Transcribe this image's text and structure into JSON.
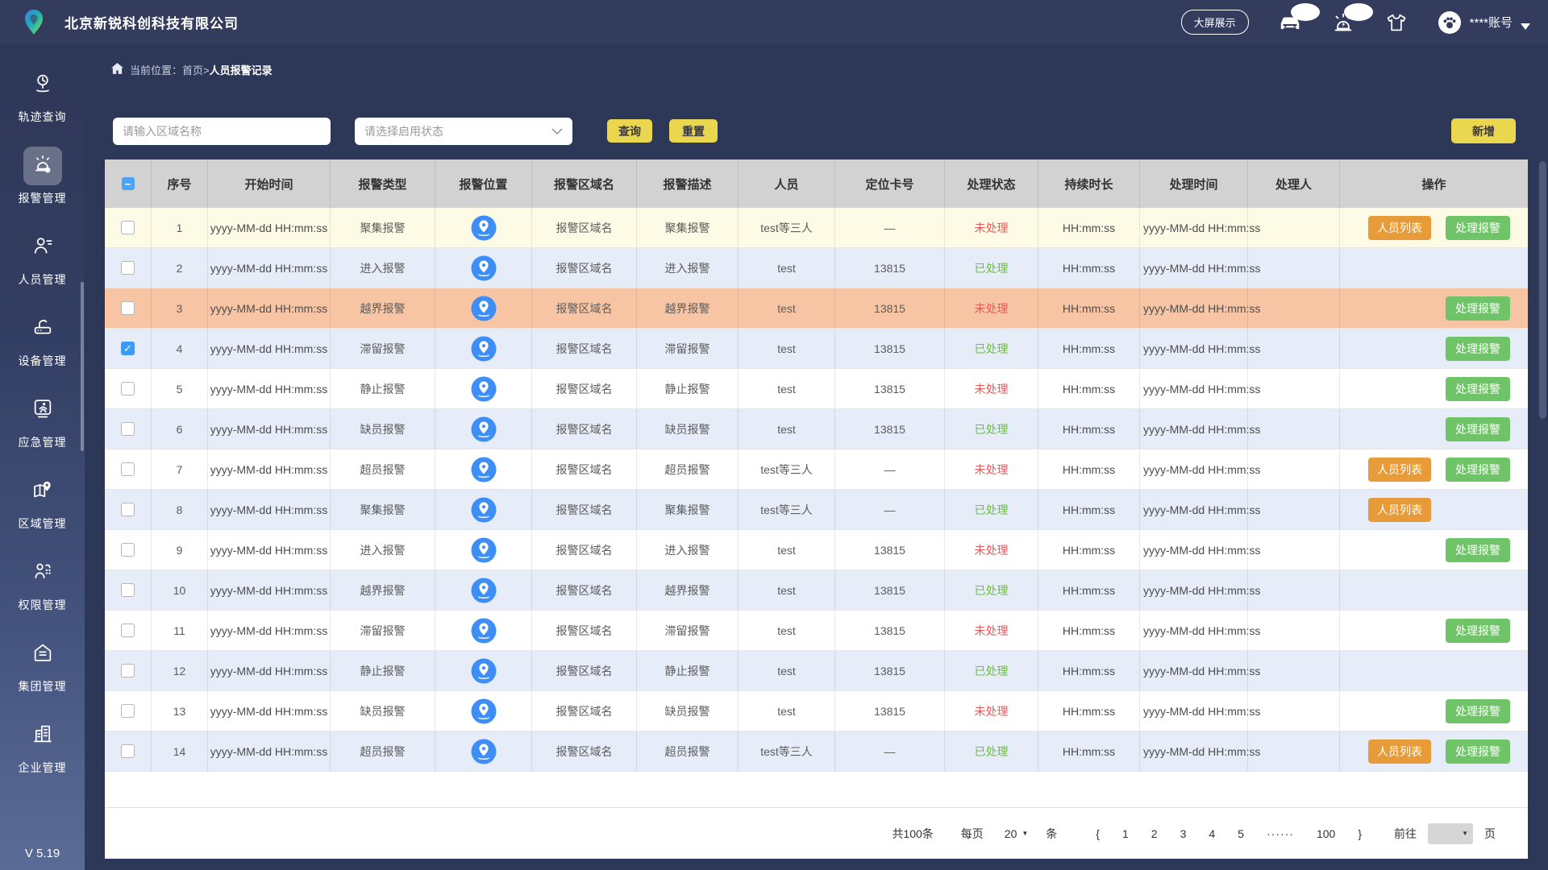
{
  "colors": {
    "topbar_bg": "#343c5e",
    "content_bg": "#2d3757",
    "accent_yellow": "#ead74f",
    "row_yellow": "#fdfbe6",
    "row_blue": "#e7ecf9",
    "row_orange": "#f8c5a4",
    "status_pending_red": "#f25555",
    "status_done_green": "#67c23a",
    "btn_orange": "#e79c39",
    "btn_green": "#6fc467",
    "loc_icon_blue": "#3e8ef7",
    "header_gray": "#d2d2d2"
  },
  "header": {
    "company": "北京新锐科创科技有限公司",
    "bigscreen_label": "大屏展示",
    "account": "****账号",
    "icons": [
      "car-icon",
      "siren-icon",
      "tshirt-icon",
      "paw-avatar-icon",
      "chevron-down-icon"
    ]
  },
  "sidebar": {
    "items": [
      {
        "label": "轨迹查询",
        "icon": "track",
        "active": false
      },
      {
        "label": "报警管理",
        "icon": "alarm",
        "active": true
      },
      {
        "label": "人员管理",
        "icon": "person",
        "active": false
      },
      {
        "label": "设备管理",
        "icon": "device",
        "active": false
      },
      {
        "label": "应急管理",
        "icon": "emergency",
        "active": false
      },
      {
        "label": "区域管理",
        "icon": "area",
        "active": false
      },
      {
        "label": "权限管理",
        "icon": "permission",
        "active": false
      },
      {
        "label": "集团管理",
        "icon": "group",
        "active": false
      },
      {
        "label": "企业管理",
        "icon": "enterprise",
        "active": false
      }
    ],
    "version": "V 5.19"
  },
  "breadcrumb": {
    "prefix": "当前位置：首页>",
    "current": "人员报警记录"
  },
  "filters": {
    "area_placeholder": "请输入区域名称",
    "status_placeholder": "请选择启用状态",
    "search_label": "查询",
    "reset_label": "重置",
    "add_label": "新增"
  },
  "table": {
    "columns": [
      "序号",
      "开始时间",
      "报警类型",
      "报警位置",
      "报警区域名",
      "报警描述",
      "人员",
      "定位卡号",
      "处理状态",
      "持续时长",
      "处理时间",
      "处理人",
      "操作"
    ],
    "action_labels": {
      "person_list": "人员列表",
      "handle": "处理报警"
    },
    "header_checkbox_state": "indeterminate",
    "rows": [
      {
        "no": "1",
        "start": "yyyy-MM-dd HH:mm:ss",
        "type": "聚集报警",
        "area": "报警区域名",
        "desc": "聚集报警",
        "person": "test等三人",
        "card": "—",
        "status": "未处理",
        "status_type": "pending",
        "duration": "HH:mm:ss",
        "handle_time": "yyyy-MM-dd HH:mm:ss",
        "handler": "",
        "checked": false,
        "bg": "yellow",
        "buttons": [
          "person_list",
          "handle"
        ]
      },
      {
        "no": "2",
        "start": "yyyy-MM-dd HH:mm:ss",
        "type": "进入报警",
        "area": "报警区域名",
        "desc": "进入报警",
        "person": "test",
        "card": "13815",
        "status": "已处理",
        "status_type": "done",
        "duration": "HH:mm:ss",
        "handle_time": "yyyy-MM-dd HH:mm:ss",
        "handler": "",
        "checked": false,
        "bg": "blue",
        "buttons": []
      },
      {
        "no": "3",
        "start": "yyyy-MM-dd HH:mm:ss",
        "type": "越界报警",
        "area": "报警区域名",
        "desc": "越界报警",
        "person": "test",
        "card": "13815",
        "status": "未处理",
        "status_type": "pending",
        "duration": "HH:mm:ss",
        "handle_time": "yyyy-MM-dd HH:mm:ss",
        "handler": "",
        "checked": false,
        "bg": "orange",
        "buttons": [
          "handle"
        ]
      },
      {
        "no": "4",
        "start": "yyyy-MM-dd HH:mm:ss",
        "type": "滞留报警",
        "area": "报警区域名",
        "desc": "滞留报警",
        "person": "test",
        "card": "13815",
        "status": "已处理",
        "status_type": "done",
        "duration": "HH:mm:ss",
        "handle_time": "yyyy-MM-dd HH:mm:ss",
        "handler": "",
        "checked": true,
        "bg": "blue",
        "buttons": [
          "handle"
        ]
      },
      {
        "no": "5",
        "start": "yyyy-MM-dd HH:mm:ss",
        "type": "静止报警",
        "area": "报警区域名",
        "desc": "静止报警",
        "person": "test",
        "card": "13815",
        "status": "未处理",
        "status_type": "pending",
        "duration": "HH:mm:ss",
        "handle_time": "yyyy-MM-dd HH:mm:ss",
        "handler": "",
        "checked": false,
        "bg": "white",
        "buttons": [
          "handle"
        ]
      },
      {
        "no": "6",
        "start": "yyyy-MM-dd HH:mm:ss",
        "type": "缺员报警",
        "area": "报警区域名",
        "desc": "缺员报警",
        "person": "test",
        "card": "13815",
        "status": "已处理",
        "status_type": "done",
        "duration": "HH:mm:ss",
        "handle_time": "yyyy-MM-dd HH:mm:ss",
        "handler": "",
        "checked": false,
        "bg": "blue",
        "buttons": [
          "handle"
        ]
      },
      {
        "no": "7",
        "start": "yyyy-MM-dd HH:mm:ss",
        "type": "超员报警",
        "area": "报警区域名",
        "desc": "超员报警",
        "person": "test等三人",
        "card": "—",
        "status": "未处理",
        "status_type": "pending",
        "duration": "HH:mm:ss",
        "handle_time": "yyyy-MM-dd HH:mm:ss",
        "handler": "",
        "checked": false,
        "bg": "white",
        "buttons": [
          "person_list",
          "handle"
        ]
      },
      {
        "no": "8",
        "start": "yyyy-MM-dd HH:mm:ss",
        "type": "聚集报警",
        "area": "报警区域名",
        "desc": "聚集报警",
        "person": "test等三人",
        "card": "—",
        "status": "已处理",
        "status_type": "done",
        "duration": "HH:mm:ss",
        "handle_time": "yyyy-MM-dd HH:mm:ss",
        "handler": "",
        "checked": false,
        "bg": "blue",
        "buttons": [
          "person_list"
        ]
      },
      {
        "no": "9",
        "start": "yyyy-MM-dd HH:mm:ss",
        "type": "进入报警",
        "area": "报警区域名",
        "desc": "进入报警",
        "person": "test",
        "card": "13815",
        "status": "未处理",
        "status_type": "pending",
        "duration": "HH:mm:ss",
        "handle_time": "yyyy-MM-dd HH:mm:ss",
        "handler": "",
        "checked": false,
        "bg": "white",
        "buttons": [
          "handle"
        ]
      },
      {
        "no": "10",
        "start": "yyyy-MM-dd HH:mm:ss",
        "type": "越界报警",
        "area": "报警区域名",
        "desc": "越界报警",
        "person": "test",
        "card": "13815",
        "status": "已处理",
        "status_type": "done",
        "duration": "HH:mm:ss",
        "handle_time": "yyyy-MM-dd HH:mm:ss",
        "handler": "",
        "checked": false,
        "bg": "blue",
        "buttons": []
      },
      {
        "no": "11",
        "start": "yyyy-MM-dd HH:mm:ss",
        "type": "滞留报警",
        "area": "报警区域名",
        "desc": "滞留报警",
        "person": "test",
        "card": "13815",
        "status": "未处理",
        "status_type": "pending",
        "duration": "HH:mm:ss",
        "handle_time": "yyyy-MM-dd HH:mm:ss",
        "handler": "",
        "checked": false,
        "bg": "white",
        "buttons": [
          "handle"
        ]
      },
      {
        "no": "12",
        "start": "yyyy-MM-dd HH:mm:ss",
        "type": "静止报警",
        "area": "报警区域名",
        "desc": "静止报警",
        "person": "test",
        "card": "13815",
        "status": "已处理",
        "status_type": "done",
        "duration": "HH:mm:ss",
        "handle_time": "yyyy-MM-dd HH:mm:ss",
        "handler": "",
        "checked": false,
        "bg": "blue",
        "buttons": []
      },
      {
        "no": "13",
        "start": "yyyy-MM-dd HH:mm:ss",
        "type": "缺员报警",
        "area": "报警区域名",
        "desc": "缺员报警",
        "person": "test",
        "card": "13815",
        "status": "未处理",
        "status_type": "pending",
        "duration": "HH:mm:ss",
        "handle_time": "yyyy-MM-dd HH:mm:ss",
        "handler": "",
        "checked": false,
        "bg": "white",
        "buttons": [
          "handle"
        ]
      },
      {
        "no": "14",
        "start": "yyyy-MM-dd HH:mm:ss",
        "type": "超员报警",
        "area": "报警区域名",
        "desc": "超员报警",
        "person": "test等三人",
        "card": "—",
        "status": "已处理",
        "status_type": "done",
        "duration": "HH:mm:ss",
        "handle_time": "yyyy-MM-dd HH:mm:ss",
        "handler": "",
        "checked": false,
        "bg": "blue",
        "buttons": [
          "person_list",
          "handle"
        ]
      }
    ]
  },
  "pagination": {
    "total": "共100条",
    "per_page_label": "每页",
    "per_page": "20",
    "unit": "条",
    "prev": "{",
    "pages": [
      "1",
      "2",
      "3",
      "4",
      "5"
    ],
    "ellipsis": "······",
    "last_page": "100",
    "next": "}",
    "goto_label": "前往",
    "page_suffix": "页"
  }
}
